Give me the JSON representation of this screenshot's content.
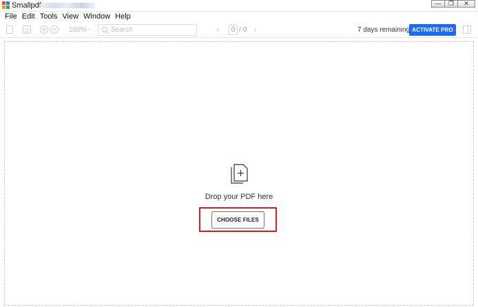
{
  "window": {
    "title": "Smallpdf",
    "controls": {
      "minimize_icon": "minimize-icon",
      "restore_icon": "restore-icon",
      "close_icon": "close-icon",
      "minimize_glyph": "—",
      "restore_glyph": "❐",
      "close_glyph": "✕"
    }
  },
  "menu": {
    "items": [
      "File",
      "Edit",
      "Tools",
      "View",
      "Window",
      "Help"
    ]
  },
  "toolbar": {
    "zoom": "100%",
    "search_placeholder": "Search",
    "page_current": "0",
    "page_separator": "/",
    "page_total": "0",
    "prev_glyph": "‹",
    "next_glyph": "›",
    "trial_text": "7 days remaining",
    "activate_label": "ACTIVATE PRO"
  },
  "dropzone": {
    "message": "Drop your PDF here",
    "choose_label": "CHOOSE FILES"
  },
  "colors": {
    "accent": "#1e6cf2",
    "highlight": "#e0191c"
  }
}
